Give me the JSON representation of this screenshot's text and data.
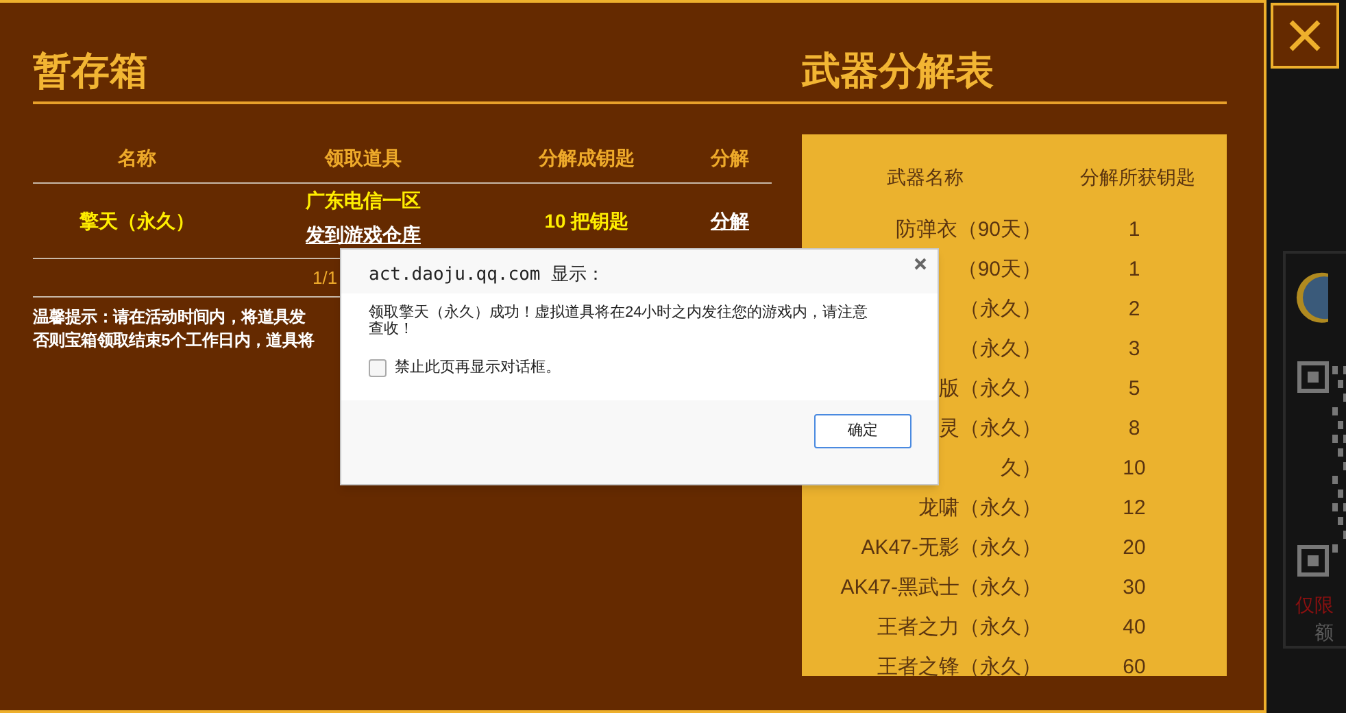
{
  "storage": {
    "title": "暂存箱",
    "columns": [
      "名称",
      "领取道具",
      "分解成钥匙",
      "分解"
    ],
    "rows": [
      {
        "name": "擎天（永久）",
        "server": "广东电信一区",
        "send_link": "发到游戏仓库",
        "keys": "10 把钥匙",
        "action": "分解"
      }
    ],
    "pager": "1/1",
    "tip_lines": [
      "温馨提示：请在活动时间内，将道具发",
      "否则宝箱领取结束5个工作日内，道具将"
    ]
  },
  "table": {
    "title": "武器分解表",
    "columns": [
      "武器名称",
      "分解所获钥匙"
    ],
    "rows": [
      {
        "name": "防弹衣（90天）",
        "keys": "1"
      },
      {
        "name": "（90天）",
        "keys": "1"
      },
      {
        "name": "（永久）",
        "keys": "2"
      },
      {
        "name": "（永久）",
        "keys": "3"
      },
      {
        "name": "版（永久）",
        "keys": "5"
      },
      {
        "name": "灵（永久）",
        "keys": "8"
      },
      {
        "name": "久）",
        "keys": "10"
      },
      {
        "name": "龙啸（永久）",
        "keys": "12"
      },
      {
        "name": "AK47-无影（永久）",
        "keys": "20"
      },
      {
        "name": "AK47-黑武士（永久）",
        "keys": "30"
      },
      {
        "name": "王者之力（永久）",
        "keys": "40"
      },
      {
        "name": "王者之锋（永久）",
        "keys": "60"
      }
    ]
  },
  "dialog": {
    "origin": "act.daoju.qq.com 显示：",
    "message": "领取擎天（永久）成功！虚拟道具将在24小时之内发往您的游戏内，请注意查收！",
    "checkbox": {
      "label": "禁止此页再显示对话框。",
      "checked": false
    },
    "ok": "确定"
  },
  "backdrop": {
    "promo_lines": [
      {
        "text": "仅限",
        "color": "#8a1010"
      },
      {
        "text": "额",
        "color": "#5a5a5a"
      }
    ]
  }
}
